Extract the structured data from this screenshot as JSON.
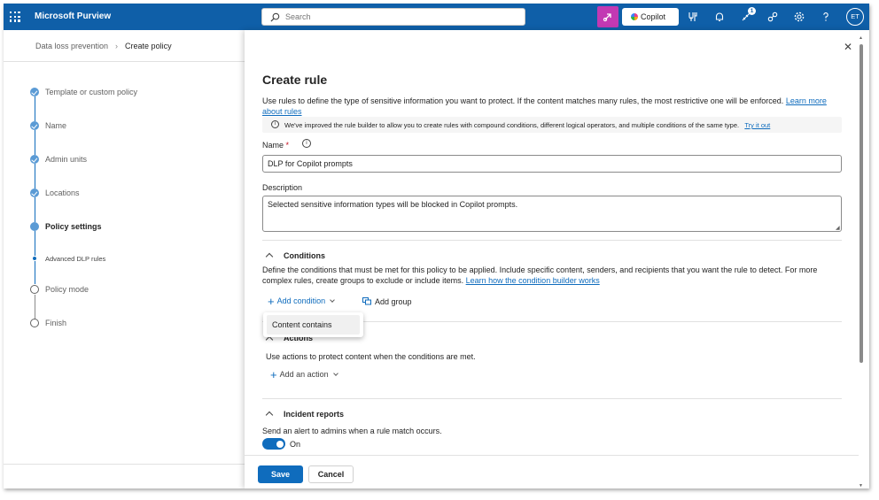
{
  "app": {
    "name": "Microsoft Purview"
  },
  "search": {
    "placeholder": "Search"
  },
  "topbar": {
    "copilot_label": "Copilot",
    "notification_count": "1",
    "avatar_initials": "ET"
  },
  "breadcrumb": {
    "parent": "Data loss prevention",
    "current": "Create policy"
  },
  "steps": [
    {
      "label": "Template or custom policy",
      "state": "done"
    },
    {
      "label": "Name",
      "state": "done"
    },
    {
      "label": "Admin units",
      "state": "done"
    },
    {
      "label": "Locations",
      "state": "done"
    },
    {
      "label": "Policy settings",
      "state": "current"
    },
    {
      "label": "Advanced DLP rules",
      "state": "sub"
    },
    {
      "label": "Policy mode",
      "state": "todo"
    },
    {
      "label": "Finish",
      "state": "todo"
    }
  ],
  "panel": {
    "title": "Create rule",
    "intro": "Use rules to define the type of sensitive information you want to protect. If the content matches many rules, the most restrictive one will be enforced.",
    "intro_link": "Learn more about rules",
    "info_message": "We've improved the rule builder to allow you to create rules with compound conditions, different logical operators, and multiple conditions of the same type.",
    "info_link": "Try it out",
    "name_label": "Name",
    "name_required": "*",
    "name_value": "DLP for Copilot prompts",
    "description_label": "Description",
    "description_value": "Selected sensitive information types will be blocked in Copilot prompts."
  },
  "conditions": {
    "heading": "Conditions",
    "description": "Define the conditions that must be met for this policy to be applied. Include specific content, senders, and recipients that you want the rule to detect. For more complex rules, create groups to exclude or include items.",
    "link": "Learn how the condition builder works",
    "add_condition": "Add condition",
    "add_group": "Add group",
    "dropdown_option": "Content contains"
  },
  "actions": {
    "heading": "Actions",
    "description": "Use actions to protect content when the conditions are met.",
    "add_action": "Add an action"
  },
  "incident_reports": {
    "heading": "Incident reports",
    "description": "Send an alert to admins when a rule match occurs.",
    "toggle_label": "On",
    "toggle_on": true
  },
  "footer": {
    "save": "Save",
    "cancel": "Cancel"
  },
  "colors": {
    "topbar": "#0f5fa8",
    "accent": "#0f6cbd",
    "copilot_button": "#c239b3"
  }
}
